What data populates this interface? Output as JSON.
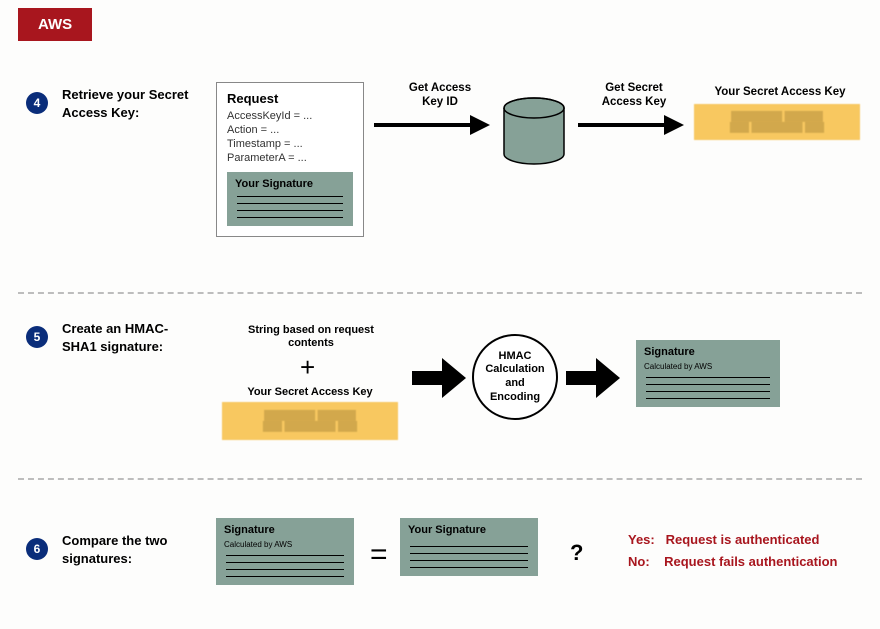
{
  "badge": "AWS",
  "step4": {
    "num": "4",
    "title": "Retrieve your Secret Access Key:",
    "request": {
      "heading": "Request",
      "lines": [
        "AccessKeyId = ...",
        "Action = ...",
        "Timestamp = ...",
        "ParameterA = ..."
      ],
      "sig": "Your Signature"
    },
    "arrow1": "Get Access Key ID",
    "arrow2": "Get Secret Access Key",
    "result_label": "Your Secret Access Key"
  },
  "step5": {
    "num": "5",
    "title": "Create an HMAC-SHA1 signature:",
    "top_text": "String based on request contents",
    "bottom_text": "Your Secret Access Key",
    "hmac": "HMAC Calculation and Encoding",
    "sig_title": "Signature",
    "sig_sub": "Calculated by AWS"
  },
  "step6": {
    "num": "6",
    "title": "Compare the two signatures:",
    "left_sig_title": "Signature",
    "left_sig_sub": "Calculated by AWS",
    "right_sig_title": "Your Signature",
    "eq": "=",
    "q": "?",
    "yes_label": "Yes:",
    "yes_text": "Request is authenticated",
    "no_label": "No:",
    "no_text": "Request fails authentication"
  }
}
